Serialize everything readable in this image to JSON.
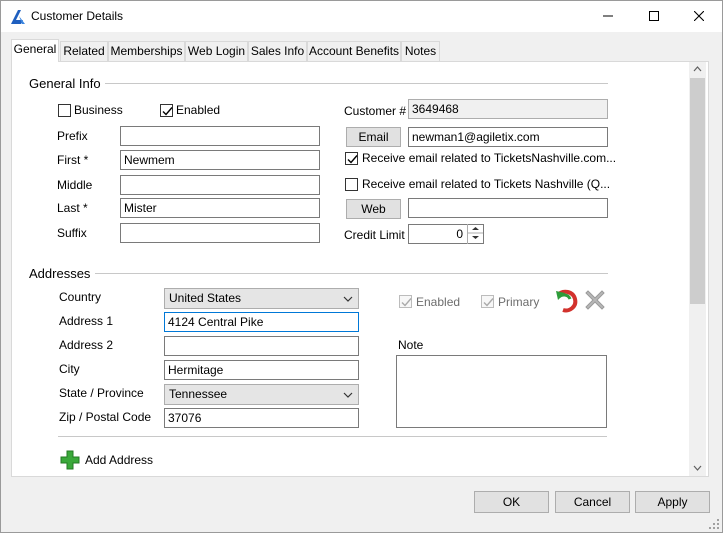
{
  "window": {
    "title": "Customer Details"
  },
  "tabs": [
    {
      "label": "General"
    },
    {
      "label": "Related"
    },
    {
      "label": "Memberships"
    },
    {
      "label": "Web Login"
    },
    {
      "label": "Sales Info"
    },
    {
      "label": "Account Benefits"
    },
    {
      "label": "Notes"
    }
  ],
  "general_info": {
    "title": "General Info",
    "business_label": "Business",
    "business_checked": false,
    "enabled_label": "Enabled",
    "enabled_checked": true,
    "prefix_label": "Prefix",
    "prefix_value": "",
    "first_label": "First *",
    "first_value": "Newmem",
    "middle_label": "Middle",
    "middle_value": "",
    "last_label": "Last *",
    "last_value": "Mister",
    "suffix_label": "Suffix",
    "suffix_value": "",
    "customer_label": "Customer #",
    "customer_value": "3649468",
    "email_button": "Email",
    "email_value": "newman1@agiletix.com",
    "receive_email_1_label": "Receive email related to TicketsNashville.com...",
    "receive_email_1_checked": true,
    "receive_email_2_label": "Receive email related to Tickets Nashville (Q...",
    "receive_email_2_checked": false,
    "web_button": "Web",
    "web_value": "",
    "credit_limit_label": "Credit Limit",
    "credit_limit_value": "0"
  },
  "addresses": {
    "title": "Addresses",
    "country_label": "Country",
    "country_value": "United States",
    "address1_label": "Address 1",
    "address1_value": "4124 Central Pike",
    "address2_label": "Address 2",
    "address2_value": "",
    "city_label": "City",
    "city_value": "Hermitage",
    "state_label": "State / Province",
    "state_value": "Tennessee",
    "zip_label": "Zip / Postal Code",
    "zip_value": "37076",
    "enabled_label": "Enabled",
    "primary_label": "Primary",
    "note_label": "Note",
    "note_value": "",
    "add_address_label": "Add Address"
  },
  "footer": {
    "ok_label": "OK",
    "cancel_label": "Cancel",
    "apply_label": "Apply"
  },
  "icons": {
    "app": "app-logo-icon",
    "minimize": "minimize-icon",
    "maximize": "maximize-icon",
    "close": "close-icon",
    "undo": "undo-icon",
    "delete": "delete-x-icon",
    "add": "plus-icon"
  }
}
